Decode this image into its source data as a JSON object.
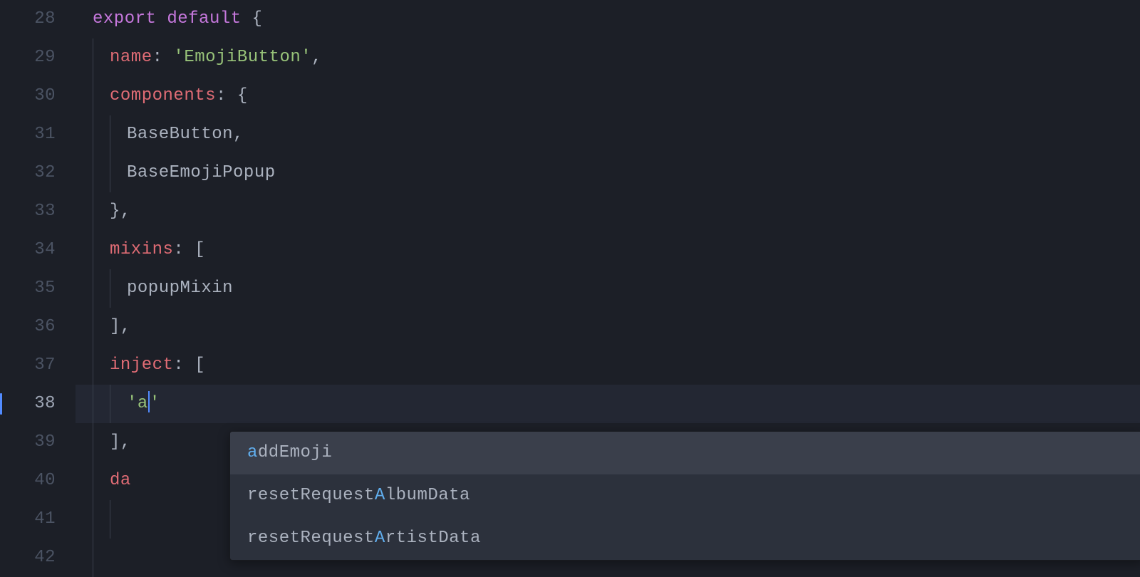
{
  "lines": [
    {
      "n": 28,
      "active": false,
      "current": false,
      "indent": 0,
      "tokens": [
        [
          "kw",
          "export"
        ],
        [
          "pn",
          " "
        ],
        [
          "kw",
          "default"
        ],
        [
          "pn",
          " {"
        ]
      ]
    },
    {
      "n": 29,
      "active": false,
      "current": false,
      "indent": 1,
      "tokens": [
        [
          "key",
          "name"
        ],
        [
          "pn",
          ": "
        ],
        [
          "str",
          "'EmojiButton'"
        ],
        [
          "pn",
          ","
        ]
      ]
    },
    {
      "n": 30,
      "active": false,
      "current": false,
      "indent": 1,
      "tokens": [
        [
          "key",
          "components"
        ],
        [
          "pn",
          ": {"
        ]
      ]
    },
    {
      "n": 31,
      "active": false,
      "current": false,
      "indent": 2,
      "tokens": [
        [
          "id",
          "BaseButton"
        ],
        [
          "pn",
          ","
        ]
      ]
    },
    {
      "n": 32,
      "active": false,
      "current": false,
      "indent": 2,
      "tokens": [
        [
          "id",
          "BaseEmojiPopup"
        ]
      ]
    },
    {
      "n": 33,
      "active": false,
      "current": false,
      "indent": 1,
      "tokens": [
        [
          "pn",
          "},"
        ]
      ]
    },
    {
      "n": 34,
      "active": false,
      "current": false,
      "indent": 1,
      "tokens": [
        [
          "key",
          "mixins"
        ],
        [
          "pn",
          ": ["
        ]
      ]
    },
    {
      "n": 35,
      "active": false,
      "current": false,
      "indent": 2,
      "tokens": [
        [
          "id",
          "popupMixin"
        ]
      ]
    },
    {
      "n": 36,
      "active": false,
      "current": false,
      "indent": 1,
      "tokens": [
        [
          "pn",
          "],"
        ]
      ]
    },
    {
      "n": 37,
      "active": false,
      "current": false,
      "indent": 1,
      "tokens": [
        [
          "key",
          "inject"
        ],
        [
          "pn",
          ": ["
        ]
      ]
    },
    {
      "n": 38,
      "active": true,
      "current": true,
      "indent": 2,
      "tokens": [
        [
          "str",
          "'a"
        ],
        [
          "cursor",
          ""
        ],
        [
          "str",
          "'"
        ]
      ]
    },
    {
      "n": 39,
      "active": false,
      "current": false,
      "indent": 1,
      "tokens": [
        [
          "pn",
          "],"
        ]
      ]
    },
    {
      "n": 40,
      "active": false,
      "current": false,
      "indent": 1,
      "tokens": [
        [
          "key",
          "da"
        ]
      ]
    },
    {
      "n": 41,
      "active": false,
      "current": false,
      "indent": 2,
      "tokens": []
    },
    {
      "n": 42,
      "active": false,
      "current": false,
      "indent": 1,
      "tokens": []
    }
  ],
  "autocomplete": {
    "items": [
      {
        "selected": true,
        "parts": [
          [
            "hl",
            "a"
          ],
          [
            "",
            "ddEmoji"
          ]
        ]
      },
      {
        "selected": false,
        "parts": [
          [
            "",
            "resetRequest"
          ],
          [
            "hl",
            "A"
          ],
          [
            "",
            "lbumData"
          ]
        ]
      },
      {
        "selected": false,
        "parts": [
          [
            "",
            "resetRequest"
          ],
          [
            "hl",
            "A"
          ],
          [
            "",
            "rtistData"
          ]
        ]
      }
    ]
  }
}
